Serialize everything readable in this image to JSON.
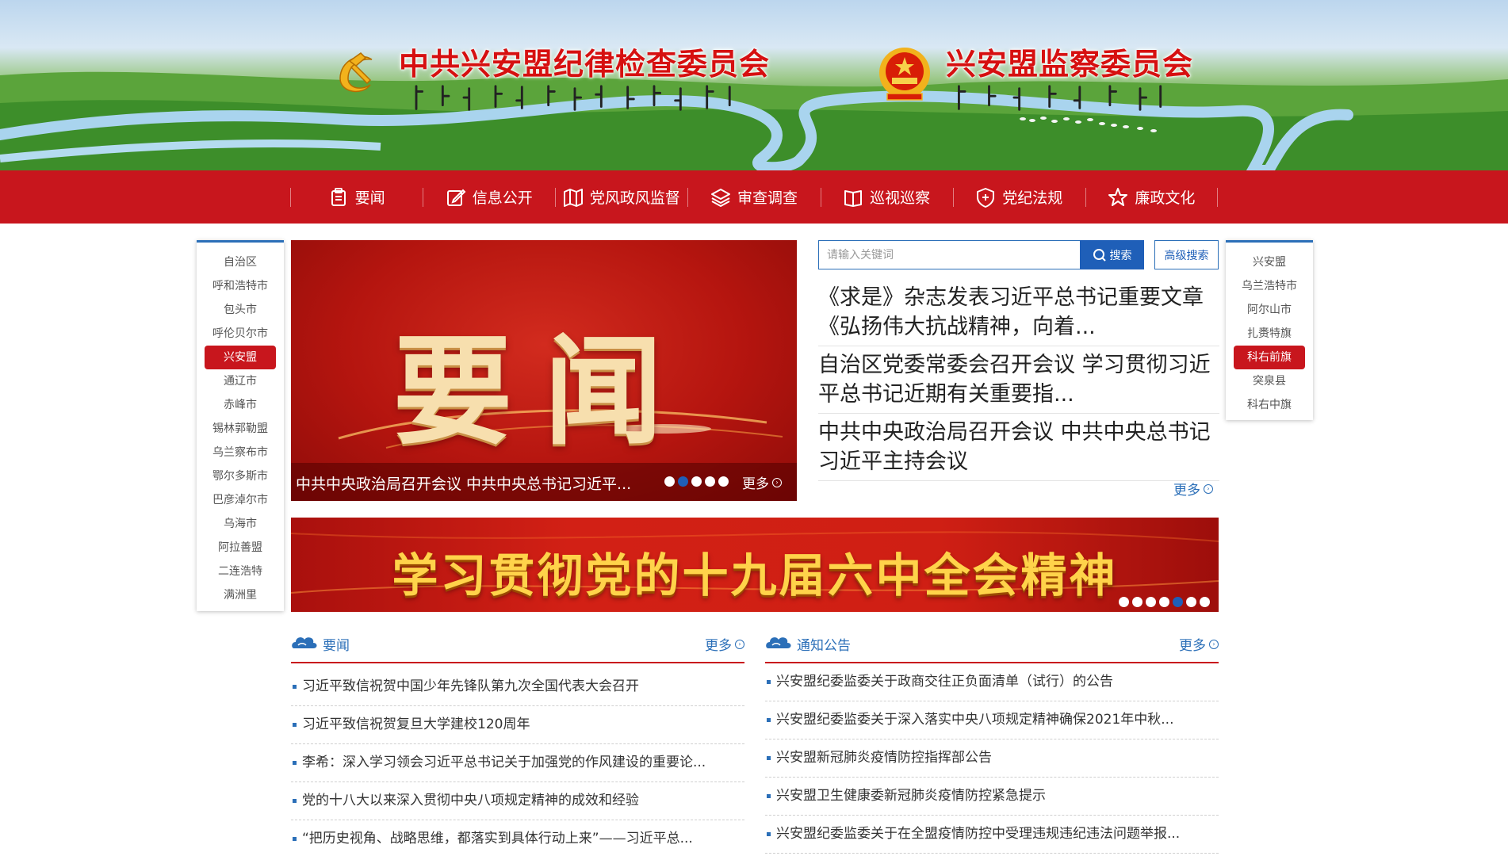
{
  "header": {
    "title_left": "中共兴安盟纪律检查委员会",
    "title_right": "兴安盟监察委员会",
    "emblem_left": "party-emblem-icon",
    "emblem_right": "national-emblem-icon"
  },
  "nav": {
    "items": [
      {
        "label": "要闻",
        "icon": "clipboard-icon"
      },
      {
        "label": "信息公开",
        "icon": "edit-icon"
      },
      {
        "label": "党风政风监督",
        "icon": "map-icon"
      },
      {
        "label": "审查调查",
        "icon": "layers-icon"
      },
      {
        "label": "巡视巡察",
        "icon": "book-icon"
      },
      {
        "label": "党纪法规",
        "icon": "shield-icon"
      },
      {
        "label": "廉政文化",
        "icon": "star-icon"
      }
    ]
  },
  "left_regions": {
    "items": [
      "自治区",
      "呼和浩特市",
      "包头市",
      "呼伦贝尔市",
      "兴安盟",
      "通辽市",
      "赤峰市",
      "锡林郭勒盟",
      "乌兰察布市",
      "鄂尔多斯市",
      "巴彦淖尔市",
      "乌海市",
      "阿拉善盟",
      "二连浩特",
      "满洲里"
    ],
    "active": "兴安盟"
  },
  "right_regions": {
    "items": [
      "兴安盟",
      "乌兰浩特市",
      "阿尔山市",
      "扎赉特旗",
      "科右前旗",
      "突泉县",
      "科右中旗"
    ],
    "active": "科右前旗"
  },
  "slider": {
    "title": "要闻",
    "caption": "中共中央政治局召开会议 中共中央总书记习近平...",
    "more": "更多",
    "dot_count": 5,
    "active_dot": 1
  },
  "search": {
    "placeholder": "请输入关键词",
    "button_label": "搜索",
    "advanced_label": "高级搜索"
  },
  "headlines": {
    "items": [
      "《求是》杂志发表习近平总书记重要文章《弘扬伟大抗战精神，向着...",
      "自治区党委常委会召开会议 学习贯彻习近平总书记近期有关重要指...",
      "中共中央政治局召开会议 中共中央总书记习近平主持会议"
    ],
    "more": "更多"
  },
  "big_banner": {
    "text": "学习贯彻党的十九届六中全会精神",
    "dot_count": 7,
    "active_dot": 4
  },
  "news_panel": {
    "title": "要闻",
    "more": "更多",
    "items": [
      "习近平致信祝贺中国少年先锋队第九次全国代表大会召开",
      "习近平致信祝贺复旦大学建校120周年",
      "李希：深入学习领会习近平总书记关于加强党的作风建设的重要论...",
      "党的十八大以来深入贯彻中央八项规定精神的成效和经验",
      "“把历史视角、战略思维，都落实到具体行动上来”——习近平总..."
    ]
  },
  "notice_panel": {
    "title": "通知公告",
    "more": "更多",
    "items": [
      "兴安盟纪委监委关于政商交往正负面清单（试行）的公告",
      "兴安盟纪委监委关于深入落实中央八项规定精神确保2021年中秋...",
      "兴安盟新冠肺炎疫情防控指挥部公告",
      "兴安盟卫生健康委新冠肺炎疫情防控紧急提示",
      "兴安盟纪委监委关于在全盟疫情防控中受理违规违纪违法问题举报..."
    ]
  },
  "colors": {
    "brand_red": "#c8161d",
    "brand_blue": "#2b6fb8",
    "title_red": "#d61010"
  }
}
